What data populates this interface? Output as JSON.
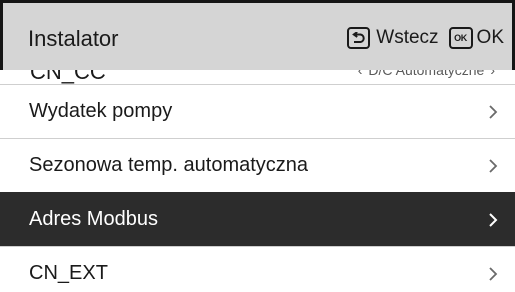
{
  "header": {
    "title": "Instalator",
    "back_label": "Wstecz",
    "ok_icon_text": "OK",
    "ok_label": "OK"
  },
  "partial_row": {
    "label": "CN_CC",
    "value": "D/C Automatyczne"
  },
  "rows": [
    {
      "label": "Wydatek pompy",
      "selected": false
    },
    {
      "label": "Sezonowa temp. automatyczna",
      "selected": false
    },
    {
      "label": "Adres Modbus",
      "selected": true
    },
    {
      "label": "CN_EXT",
      "selected": false
    }
  ],
  "icons": {
    "back": "back-arrow-icon",
    "ok": "ok-key-icon",
    "row_arrow": "chevron-right-icon"
  },
  "colors": {
    "header_bg": "#d5d5d5",
    "selected_bg": "#2c2c2c",
    "text": "#1a1a1a",
    "divider": "#cfcfcf"
  }
}
